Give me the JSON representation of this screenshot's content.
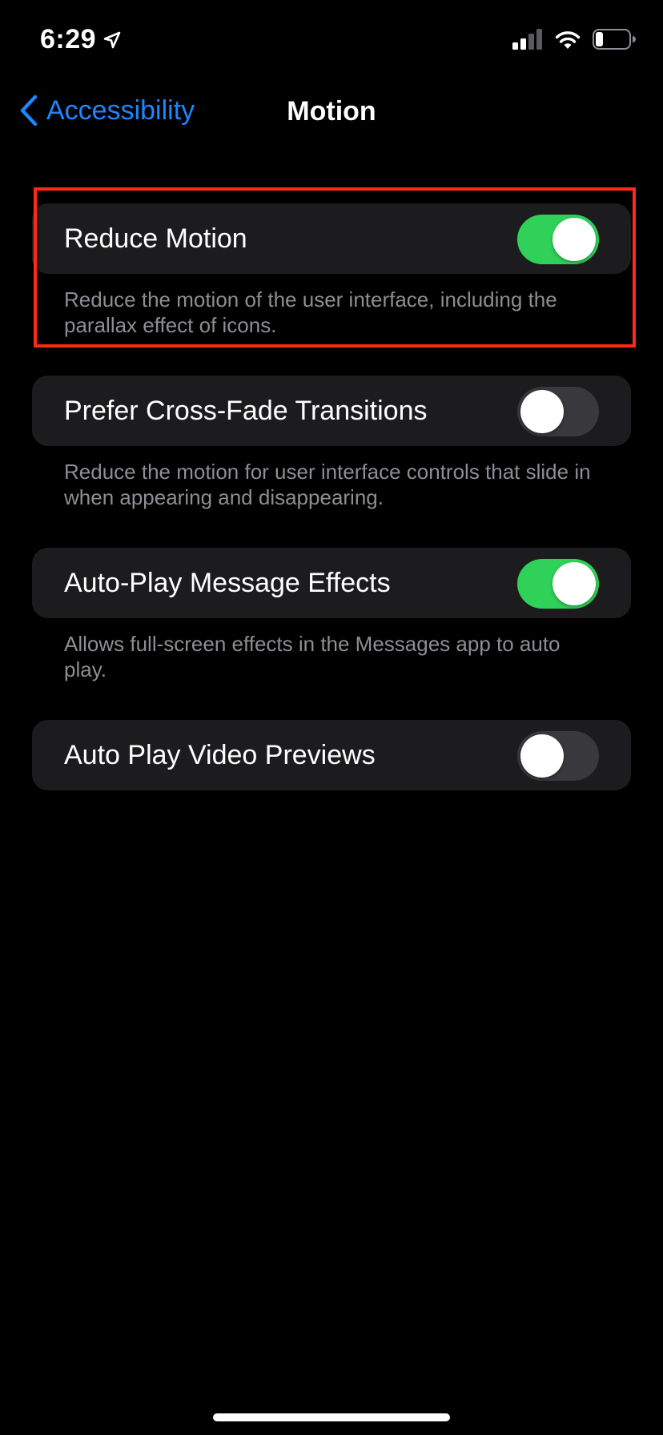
{
  "status_bar": {
    "time": "6:29",
    "location_icon": "location-arrow-icon",
    "signal_icon": "cellular-signal-icon",
    "wifi_icon": "wifi-icon",
    "battery_icon": "battery-low-icon"
  },
  "nav": {
    "back_label": "Accessibility",
    "title": "Motion"
  },
  "settings": [
    {
      "label": "Reduce Motion",
      "enabled": true,
      "description": "Reduce the motion of the user interface, including the parallax effect of icons."
    },
    {
      "label": "Prefer Cross-Fade Transitions",
      "enabled": false,
      "description": "Reduce the motion for user interface controls that slide in when appearing and disappearing."
    },
    {
      "label": "Auto-Play Message Effects",
      "enabled": true,
      "description": "Allows full-screen effects in the Messages app to auto play."
    },
    {
      "label": "Auto Play Video Previews",
      "enabled": false,
      "description": ""
    }
  ],
  "colors": {
    "accent": "#1e86ff",
    "toggle_on": "#30d158",
    "toggle_off": "#39393d",
    "highlight": "#ff2a12",
    "cell_background": "#1c1c1e"
  }
}
